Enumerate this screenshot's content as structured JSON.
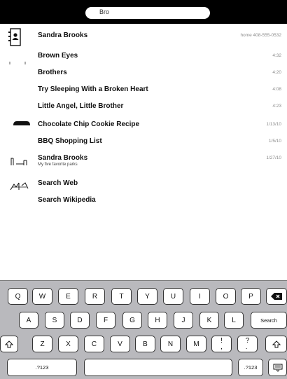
{
  "search": {
    "query": "Bro"
  },
  "results": {
    "contacts": {
      "icon": "contact-card-icon",
      "items": [
        {
          "title": "Sandra Brooks",
          "meta": "home 408-555-0532"
        }
      ]
    },
    "music": {
      "icon": "music-icon",
      "items": [
        {
          "title": "Brown Eyes",
          "meta": "4:32"
        },
        {
          "title": "Brothers",
          "meta": "4:20"
        },
        {
          "title": "Try Sleeping With a Broken Heart",
          "meta": "4:08"
        },
        {
          "title": "Little Angel, Little Brother",
          "meta": "4:23"
        }
      ]
    },
    "notes": {
      "icon": "notepad-icon",
      "items": [
        {
          "title": "Chocolate Chip Cookie Recipe",
          "meta": "1/13/10"
        },
        {
          "title": "BBQ Shopping List",
          "meta": "1/5/10"
        }
      ]
    },
    "mail": {
      "icon": "mail-icon",
      "items": [
        {
          "title": "Sandra Brooks",
          "subtitle": "My five favorite parks",
          "meta": "1/27/10"
        }
      ]
    },
    "web": {
      "icon": "web-search-icon",
      "items": [
        {
          "title": "Search Web"
        },
        {
          "title": "Search Wikipedia"
        }
      ]
    }
  },
  "keyboard": {
    "row1": [
      "Q",
      "W",
      "E",
      "R",
      "T",
      "Y",
      "U",
      "I",
      "O",
      "P"
    ],
    "row2": [
      "A",
      "S",
      "D",
      "F",
      "G",
      "H",
      "J",
      "K",
      "L"
    ],
    "row3": [
      "Z",
      "X",
      "C",
      "V",
      "B",
      "N",
      "M",
      "!\n,",
      "?\n."
    ],
    "search_label": "Search",
    "numbers_left": ".?123",
    "numbers_right": ".?123",
    "backspace_icon": "backspace-icon",
    "shift_icon": "shift-icon",
    "hide_keyboard_icon": "hide-keyboard-icon"
  }
}
